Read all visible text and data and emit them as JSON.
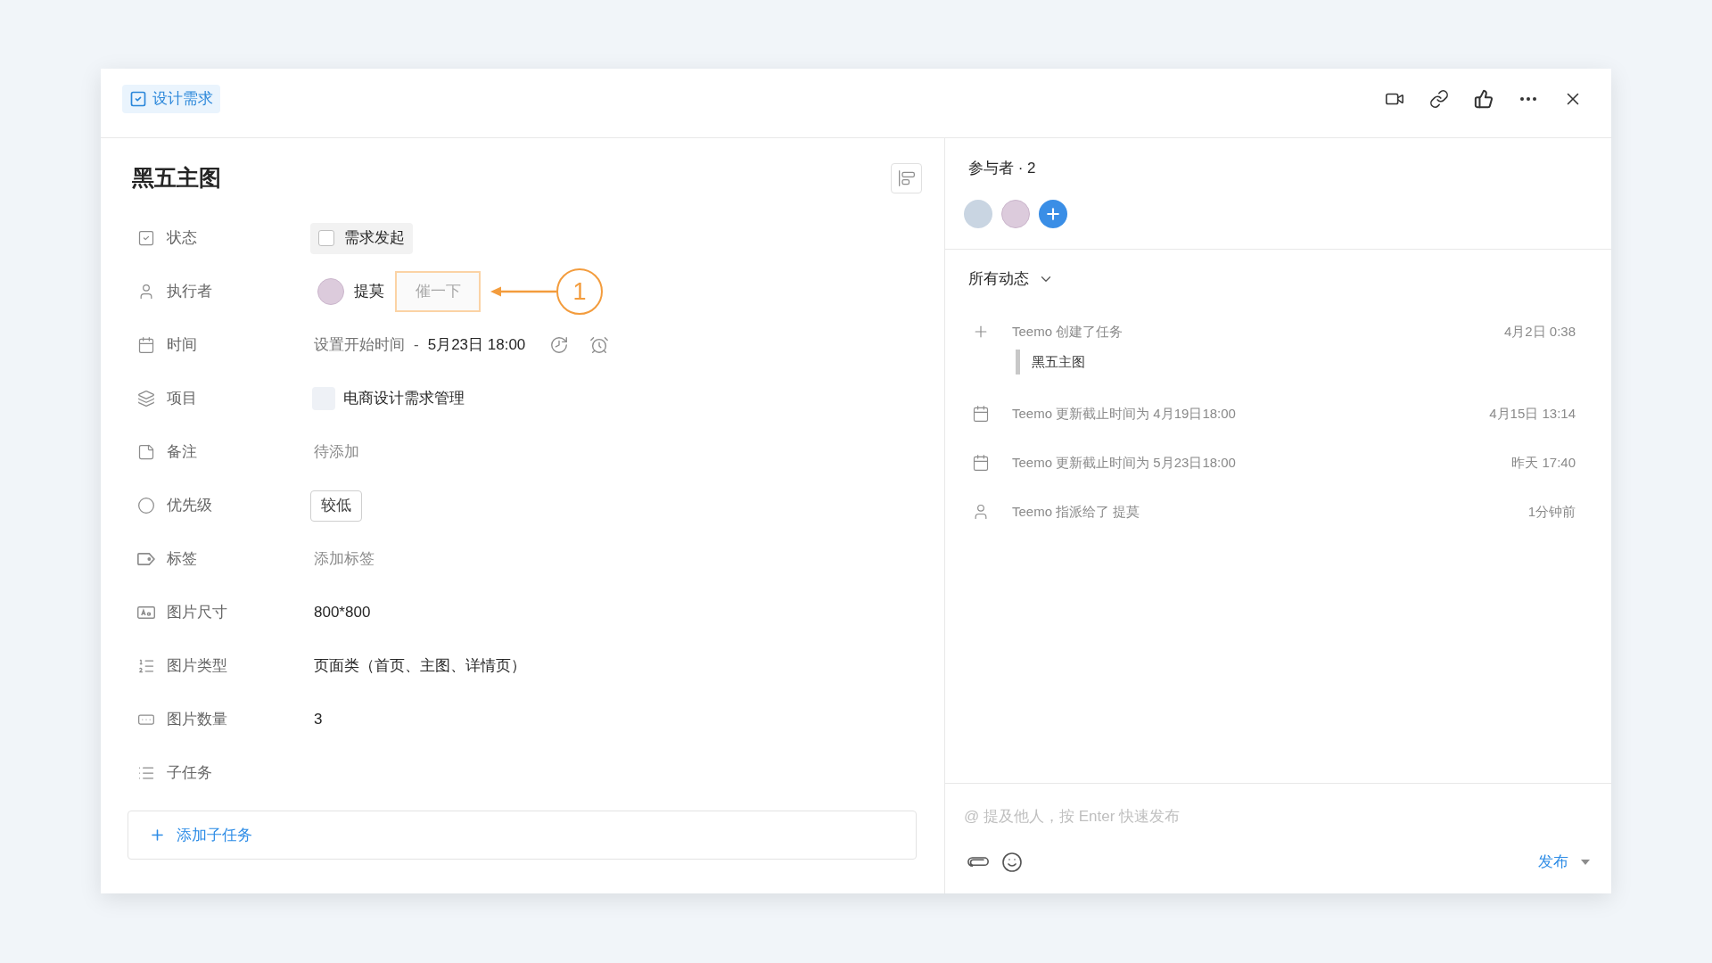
{
  "header": {
    "tag": "设计需求"
  },
  "task": {
    "title": "黑五主图"
  },
  "fields": [
    {
      "kind": "status",
      "label": "状态",
      "value": "需求发起",
      "checked": false
    },
    {
      "kind": "assignee",
      "label": "执行者",
      "value": "提莫",
      "action": "催一下"
    },
    {
      "kind": "time",
      "label": "时间",
      "start": "设置开始时间",
      "separator": "-",
      "end": "5月23日 18:00"
    },
    {
      "kind": "project",
      "label": "项目",
      "value": "电商设计需求管理"
    },
    {
      "kind": "empty",
      "label": "备注",
      "placeholder": "待添加"
    },
    {
      "kind": "pill",
      "label": "优先级",
      "value": "较低"
    },
    {
      "kind": "empty",
      "label": "标签",
      "placeholder": "添加标签"
    },
    {
      "kind": "text",
      "label": "图片尺寸",
      "value": "800*800"
    },
    {
      "kind": "text",
      "label": "图片类型",
      "value": "页面类（首页、主图、详情页）"
    },
    {
      "kind": "text",
      "label": "图片数量",
      "value": "3"
    },
    {
      "kind": "section",
      "label": "子任务"
    }
  ],
  "subtasks": {
    "add": "添加子任务"
  },
  "annotation": {
    "number": "1"
  },
  "participants": {
    "title": "参与者 · 2"
  },
  "activity": {
    "filter": "所有动态",
    "items": [
      {
        "kind": "created",
        "text": "Teemo 创建了任务",
        "time": "4月2日 0:38",
        "quote": "黑五主图"
      },
      {
        "kind": "due_date",
        "text": "Teemo 更新截止时间为 4月19日18:00",
        "time": "4月15日 13:14"
      },
      {
        "kind": "due_date",
        "text": "Teemo 更新截止时间为 5月23日18:00",
        "time": "昨天 17:40"
      },
      {
        "kind": "assigned",
        "text": "Teemo 指派给了 提莫",
        "time": "1分钟前"
      }
    ]
  },
  "comment": {
    "placeholder": "@ 提及他人，按 Enter 快速发布",
    "submit": "发布"
  }
}
